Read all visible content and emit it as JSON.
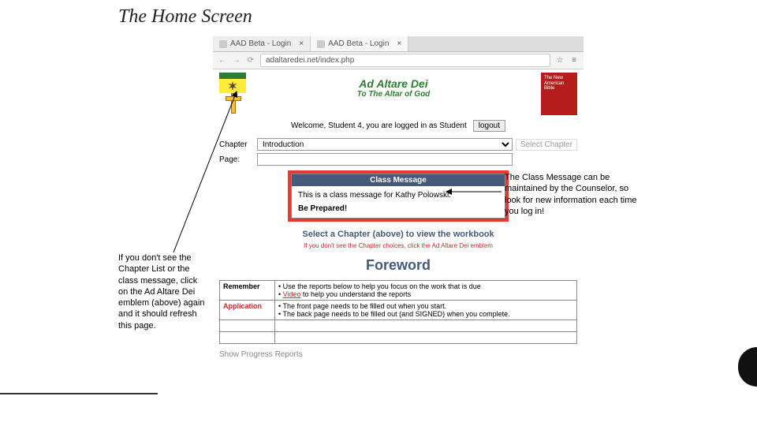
{
  "slide": {
    "title": "The Home Screen"
  },
  "browser": {
    "tab1": "AAD Beta - Login",
    "tab2": "AAD Beta - Login",
    "url": "adaltaredei.net/index.php"
  },
  "site": {
    "title": "Ad Altare Dei",
    "subtitle": "To The Altar of God",
    "book_label": "The New American Bible"
  },
  "welcome": {
    "text": "Welcome, Student 4, you are logged in as Student",
    "logout": "logout"
  },
  "selectors": {
    "chapter_label": "Chapter",
    "chapter_value": "Introduction",
    "select_btn": "Select Chapter",
    "page_label": "Page:"
  },
  "class_message": {
    "header": "Class Message",
    "line": "This is a class message for Kathy Polowski:",
    "bold": "Be Prepared!"
  },
  "prompts": {
    "select": "Select a Chapter (above) to view the workbook",
    "hint": "If you don't see the Chapter choices, click the Ad Altare Dei emblem",
    "foreword": "Foreword"
  },
  "table": {
    "r1_left": "Remember",
    "r1_b1": "Use the reports below to help you focus on the work that is due",
    "r1_b2_link": "Video",
    "r1_b2_rest": " to help you understand the reports",
    "r2_left": "Application",
    "r2_b1": "The front page needs to be filled out when you start.",
    "r2_b2": "The back page needs to be filled out (and SIGNED) when you complete."
  },
  "footer": {
    "show_reports": "Show Progress Reports"
  },
  "notes": {
    "left": "If you don't see the Chapter List or the class message, click on the Ad Altare Dei emblem (above) again and it should refresh this page.",
    "right": "The Class Message can be maintained by the Counselor, so look for new information each time you log in!"
  }
}
